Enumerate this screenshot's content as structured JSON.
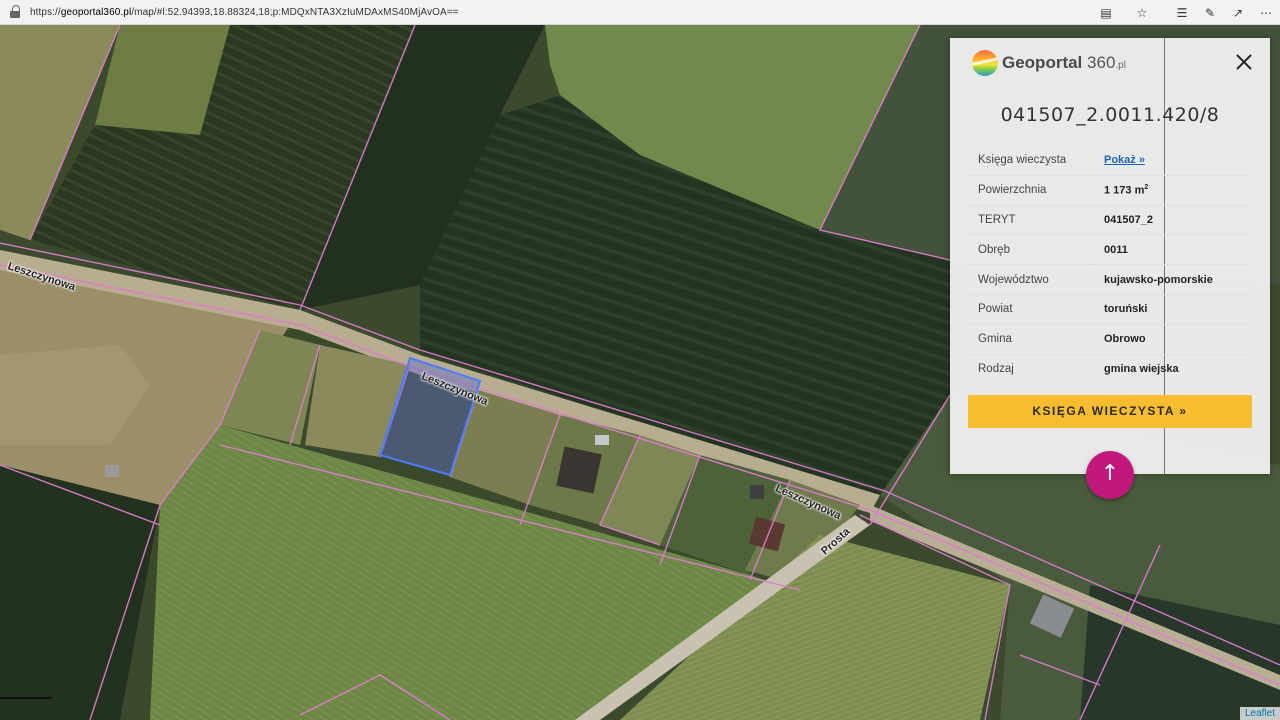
{
  "browser": {
    "url_prefix": "https://",
    "url_host": "geoportal360.pl",
    "url_path": "/map/#l:52.94393,18.88324,18;p:MDQxNTA3XzIuMDAxMS40MjAvOA==",
    "icons": [
      "reader-icon",
      "star-icon",
      "favorites-icon",
      "pen-icon",
      "share-icon",
      "more-icon"
    ]
  },
  "map": {
    "road_labels": [
      "Leszczynowa",
      "Leszczynowa",
      "Leszczynowa",
      "Prosta"
    ],
    "attribution": "Leaflet"
  },
  "panel": {
    "logo_main": "Geoportal",
    "logo_num": "360",
    "logo_tld": ".pl",
    "parcel_id": "041507_2.0011.420/8",
    "rows": [
      {
        "label": "Księga wieczysta",
        "value": "Pokaż »",
        "link": true
      },
      {
        "label": "Powierzchnia",
        "value": "1 173 m",
        "sup": "2"
      },
      {
        "label": "TERYT",
        "value": "041507_2"
      },
      {
        "label": "Obręb",
        "value": "0011"
      },
      {
        "label": "Województwo",
        "value": "kujawsko-pomorskie"
      },
      {
        "label": "Powiat",
        "value": "toruński"
      },
      {
        "label": "Gmina",
        "value": "Obrowo"
      },
      {
        "label": "Rodzaj",
        "value": "gmina wiejska"
      }
    ],
    "button_label": "KSIĘGA WIECZYSTA »",
    "up_button_glyph": "↑"
  },
  "colors": {
    "accent_button": "#f5bd2f",
    "up_button": "#c1187d",
    "parcel_outline": "#e07bd0",
    "selected_parcel": "#4c7dff"
  }
}
